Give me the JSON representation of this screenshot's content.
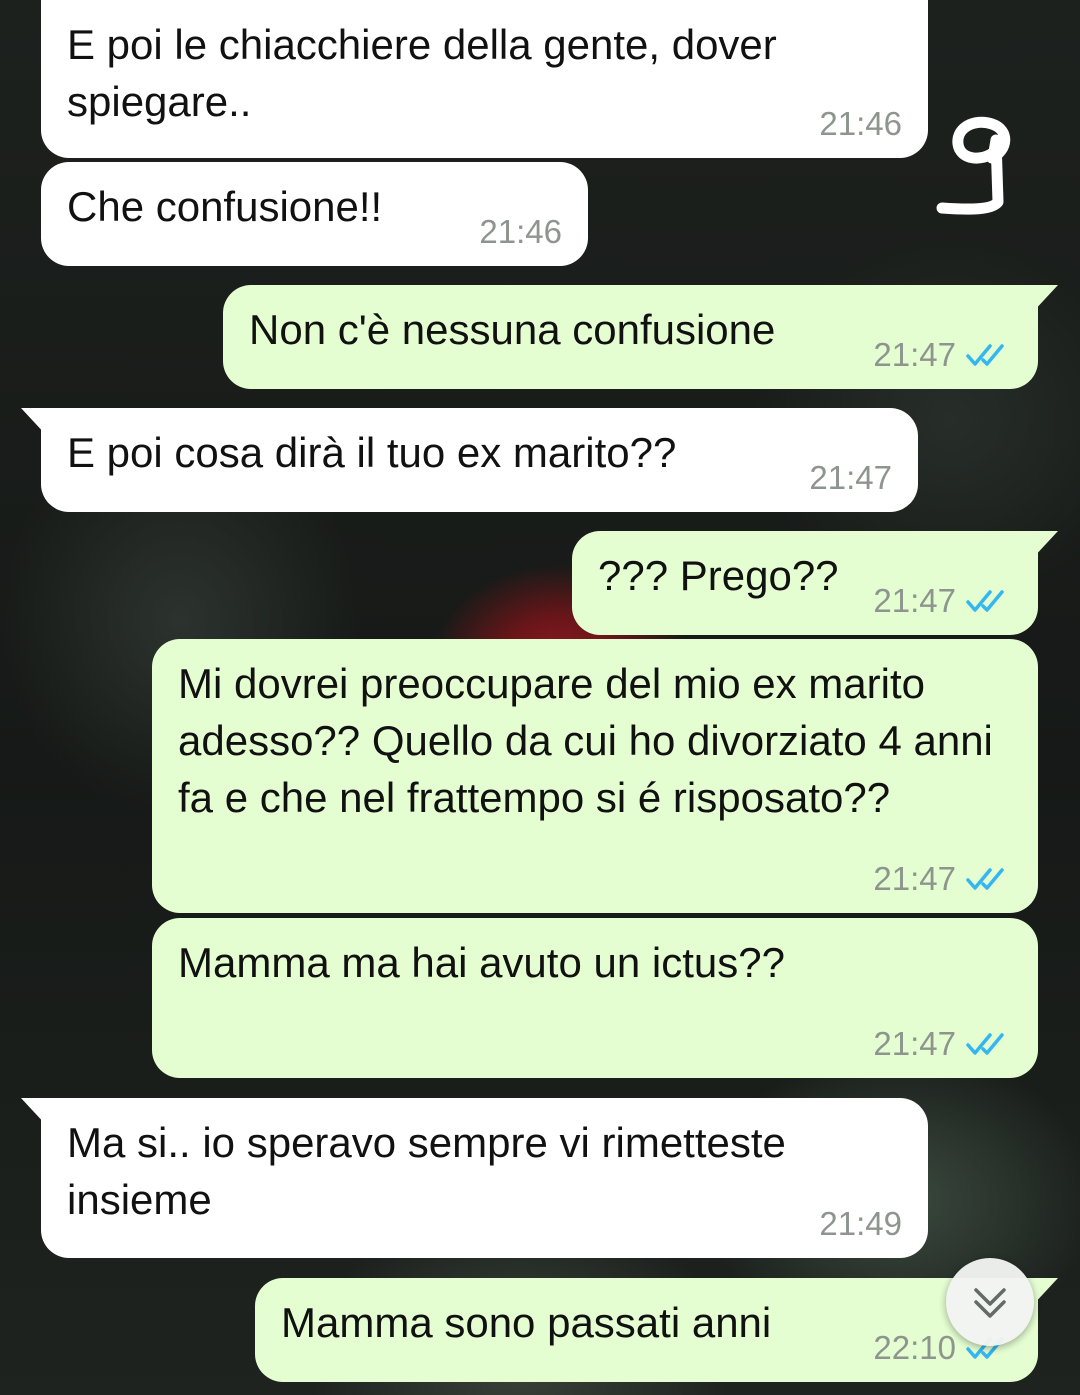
{
  "messages": [
    {
      "direction": "in",
      "text": "E poi le chiacchiere della gente, dover spiegare..",
      "time": "21:46"
    },
    {
      "direction": "in",
      "text": "Che confusione!!",
      "time": "21:46"
    },
    {
      "direction": "out",
      "text": "Non c'è nessuna confusione",
      "time": "21:47",
      "status": "read"
    },
    {
      "direction": "in",
      "text": "E poi cosa dirà il tuo ex marito??",
      "time": "21:47"
    },
    {
      "direction": "out",
      "text": "??? Prego??",
      "time": "21:47",
      "status": "read"
    },
    {
      "direction": "out",
      "text": "Mi dovrei preoccupare del mio ex marito adesso?? Quello da cui ho divorziato 4 anni fa e che nel frattempo si é risposato??",
      "time": "21:47",
      "status": "read"
    },
    {
      "direction": "out",
      "text": "Mamma ma hai avuto un ictus??",
      "time": "21:47",
      "status": "read"
    },
    {
      "direction": "in",
      "text": "Ma si.. io speravo sempre vi rimetteste insieme",
      "time": "21:49"
    },
    {
      "direction": "out",
      "text": "Mamma sono passati anni",
      "time": "22:10",
      "status": "read"
    }
  ],
  "annotation": {
    "handwritten_number": "9"
  },
  "icons": {
    "read_receipt": "double-check-icon",
    "scroll_down": "chevron-double-down-icon"
  },
  "colors": {
    "incoming_bubble": "#ffffff",
    "outgoing_bubble": "#e4fdd1",
    "read_check": "#34b7f1",
    "timestamp": "#8e958e"
  }
}
